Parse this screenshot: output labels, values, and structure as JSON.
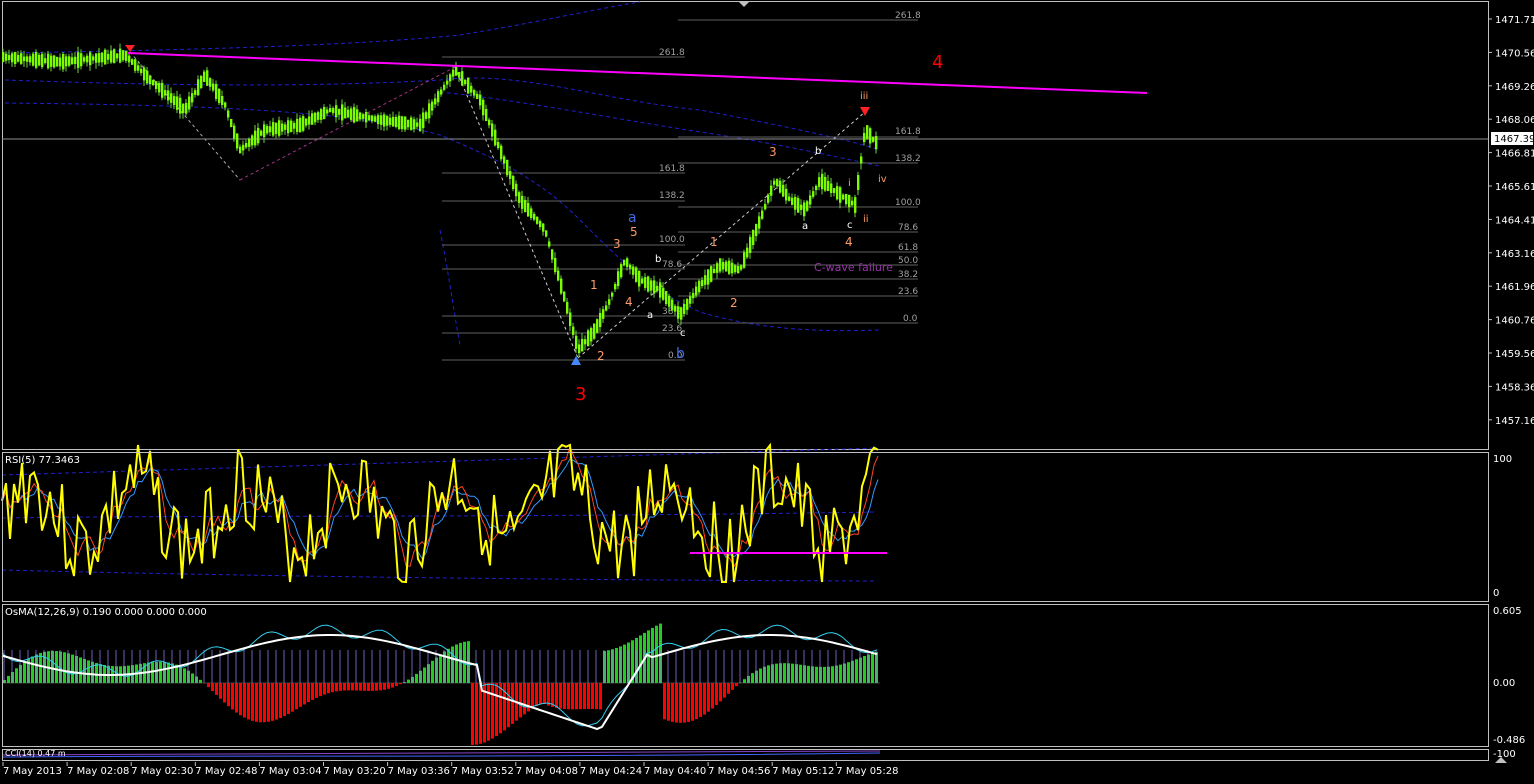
{
  "price_axis": [
    "1471.71",
    "1470.56",
    "1469.26",
    "1468.06",
    "1466.81",
    "1465.61",
    "1464.41",
    "1463.16",
    "1461.96",
    "1460.76",
    "1459.56",
    "1458.36",
    "1457.16"
  ],
  "current_price": "1467.39",
  "rsi": {
    "label": "RSI(5) 77.3463",
    "scale_top": "100",
    "scale_bottom": "0"
  },
  "osma": {
    "label": "OsMA(12,26,9) 0.190 0.000 0.000 0.000",
    "scale": [
      "0.605",
      "0.00",
      "-0.486"
    ]
  },
  "bottom_panel": {
    "label": "CCI(14) 0.47 m",
    "scale": "-100"
  },
  "time_axis": [
    "7 May 2013",
    "7 May 02:08",
    "7 May 02:30",
    "7 May 02:48",
    "7 May 03:04",
    "7 May 03:20",
    "7 May 03:36",
    "7 May 03:52",
    "7 May 04:08",
    "7 May 04:24",
    "7 May 04:40",
    "7 May 04:56",
    "7 May 05:12",
    "7 May 05:28"
  ],
  "fib_left": [
    "261.8",
    "161.8",
    "138.2",
    "100.0",
    "78.6",
    "38.2",
    "23.6",
    "0.0"
  ],
  "fib_right": [
    "261.8",
    "161.8",
    "138.2",
    "100.0",
    "78.6",
    "61.8",
    "50.0",
    "38.2",
    "23.6",
    "0.0"
  ],
  "wave_labels": {
    "big3": "3",
    "big4": "4",
    "a_blue": "a",
    "b_blue": "b",
    "o5": "5",
    "o3a": "3",
    "o4a": "4",
    "o1a": "1",
    "o2a": "2",
    "o1b": "1",
    "o2b": "2",
    "o3b": "3",
    "o4b": "4",
    "wa1": "a",
    "wb1": "b",
    "wc1": "c",
    "wa2": "a",
    "wb2": "b",
    "wc2": "c",
    "wi": "i",
    "wii": "ii",
    "wiii": "iii",
    "wiv": "iv"
  },
  "annotation": "C-wave failure",
  "colors": {
    "background": "#000000",
    "candles": "#7CFC00",
    "trendline": "#FF00FF",
    "rsi_line": "#FFFF00",
    "osma_pos": "#22CC22",
    "osma_neg": "#FF0000",
    "envelope": "#2020CC",
    "wave_red": "#FF0000",
    "wave_orange": "#FF9966",
    "wave_blue": "#4169E1"
  }
}
